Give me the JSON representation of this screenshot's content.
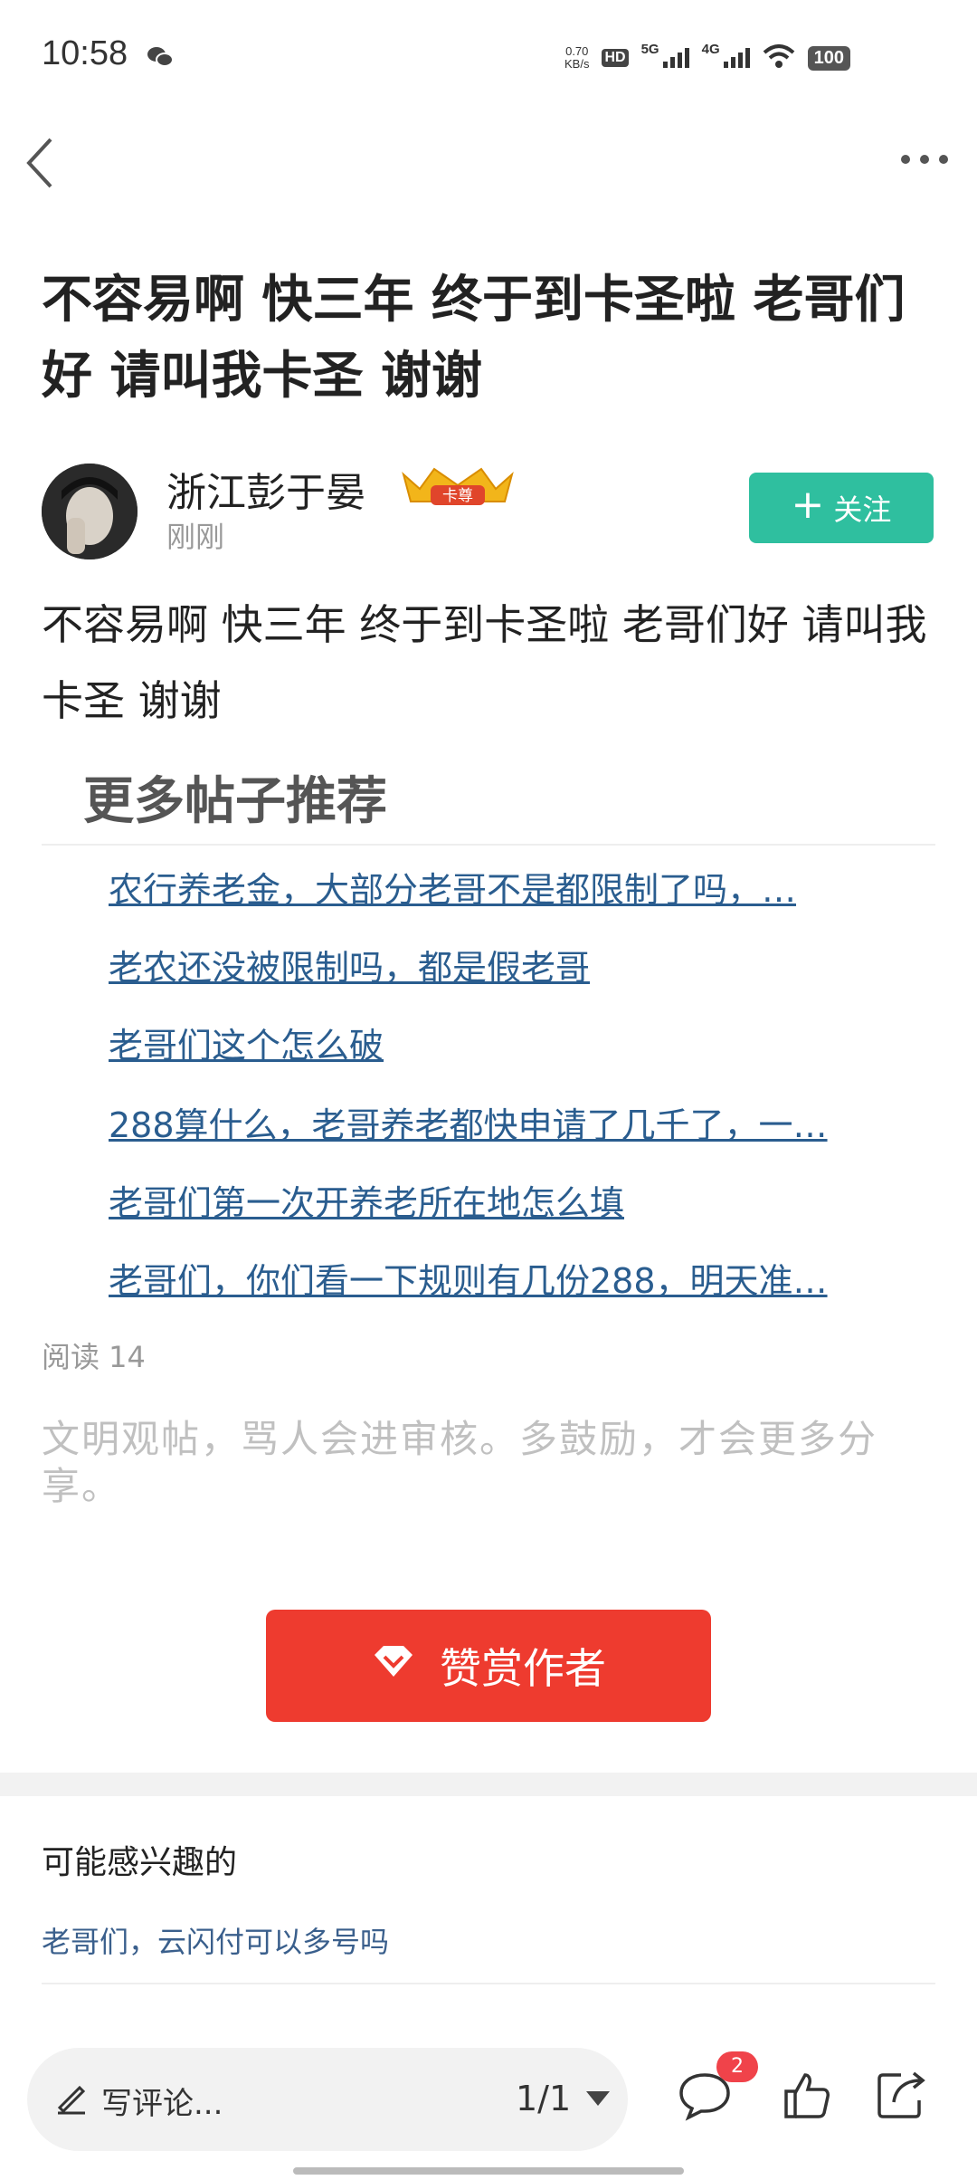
{
  "status_bar": {
    "time": "10:58",
    "net_speed_value": "0.70",
    "net_speed_unit": "KB/s",
    "hd_label": "HD",
    "sim_label_1": "5G",
    "sim_label_2": "4G",
    "battery": "100"
  },
  "post": {
    "title": "不容易啊 快三年 终于到卡圣啦 老哥们好 请叫我卡圣 谢谢",
    "author_name": "浙江彭于晏",
    "badge_text": "卡尊",
    "time": "刚刚",
    "follow_label": "关注",
    "body": "不容易啊 快三年 终于到卡圣啦 老哥们好 请叫我卡圣 谢谢"
  },
  "recommendations": {
    "heading": "更多帖子推荐",
    "items": [
      "农行养老金，大部分老哥不是都限制了吗，…",
      "老农还没被限制吗，都是假老哥",
      "老哥们这个怎么破",
      "288算什么，老哥养老都快申请了几千了，一…",
      "老哥们第一次开养老所在地怎么填",
      "老哥们，你们看一下规则有几份288，明天准…"
    ]
  },
  "stats": {
    "read_count": "阅读 14"
  },
  "notice": "文明观帖，骂人会进审核。多鼓励，才会更多分享。",
  "reward_label": "赞赏作者",
  "interest": {
    "heading": "可能感兴趣的",
    "item": "老哥们，云闪付可以多号吗"
  },
  "bottom_bar": {
    "comment_placeholder": "写评论...",
    "page_indicator": "1/1",
    "comment_count": "2"
  },
  "colors": {
    "follow_green": "#2fbf9f",
    "reward_red": "#ee3b2f",
    "link_blue": "#2a5d8f",
    "badge_red": "#f0434a"
  },
  "icons": [
    "wechat-icon",
    "back-icon",
    "more-icon",
    "crown-badge-icon",
    "plus-icon",
    "diamond-icon",
    "pencil-icon",
    "comment-icon",
    "like-icon",
    "share-icon"
  ]
}
